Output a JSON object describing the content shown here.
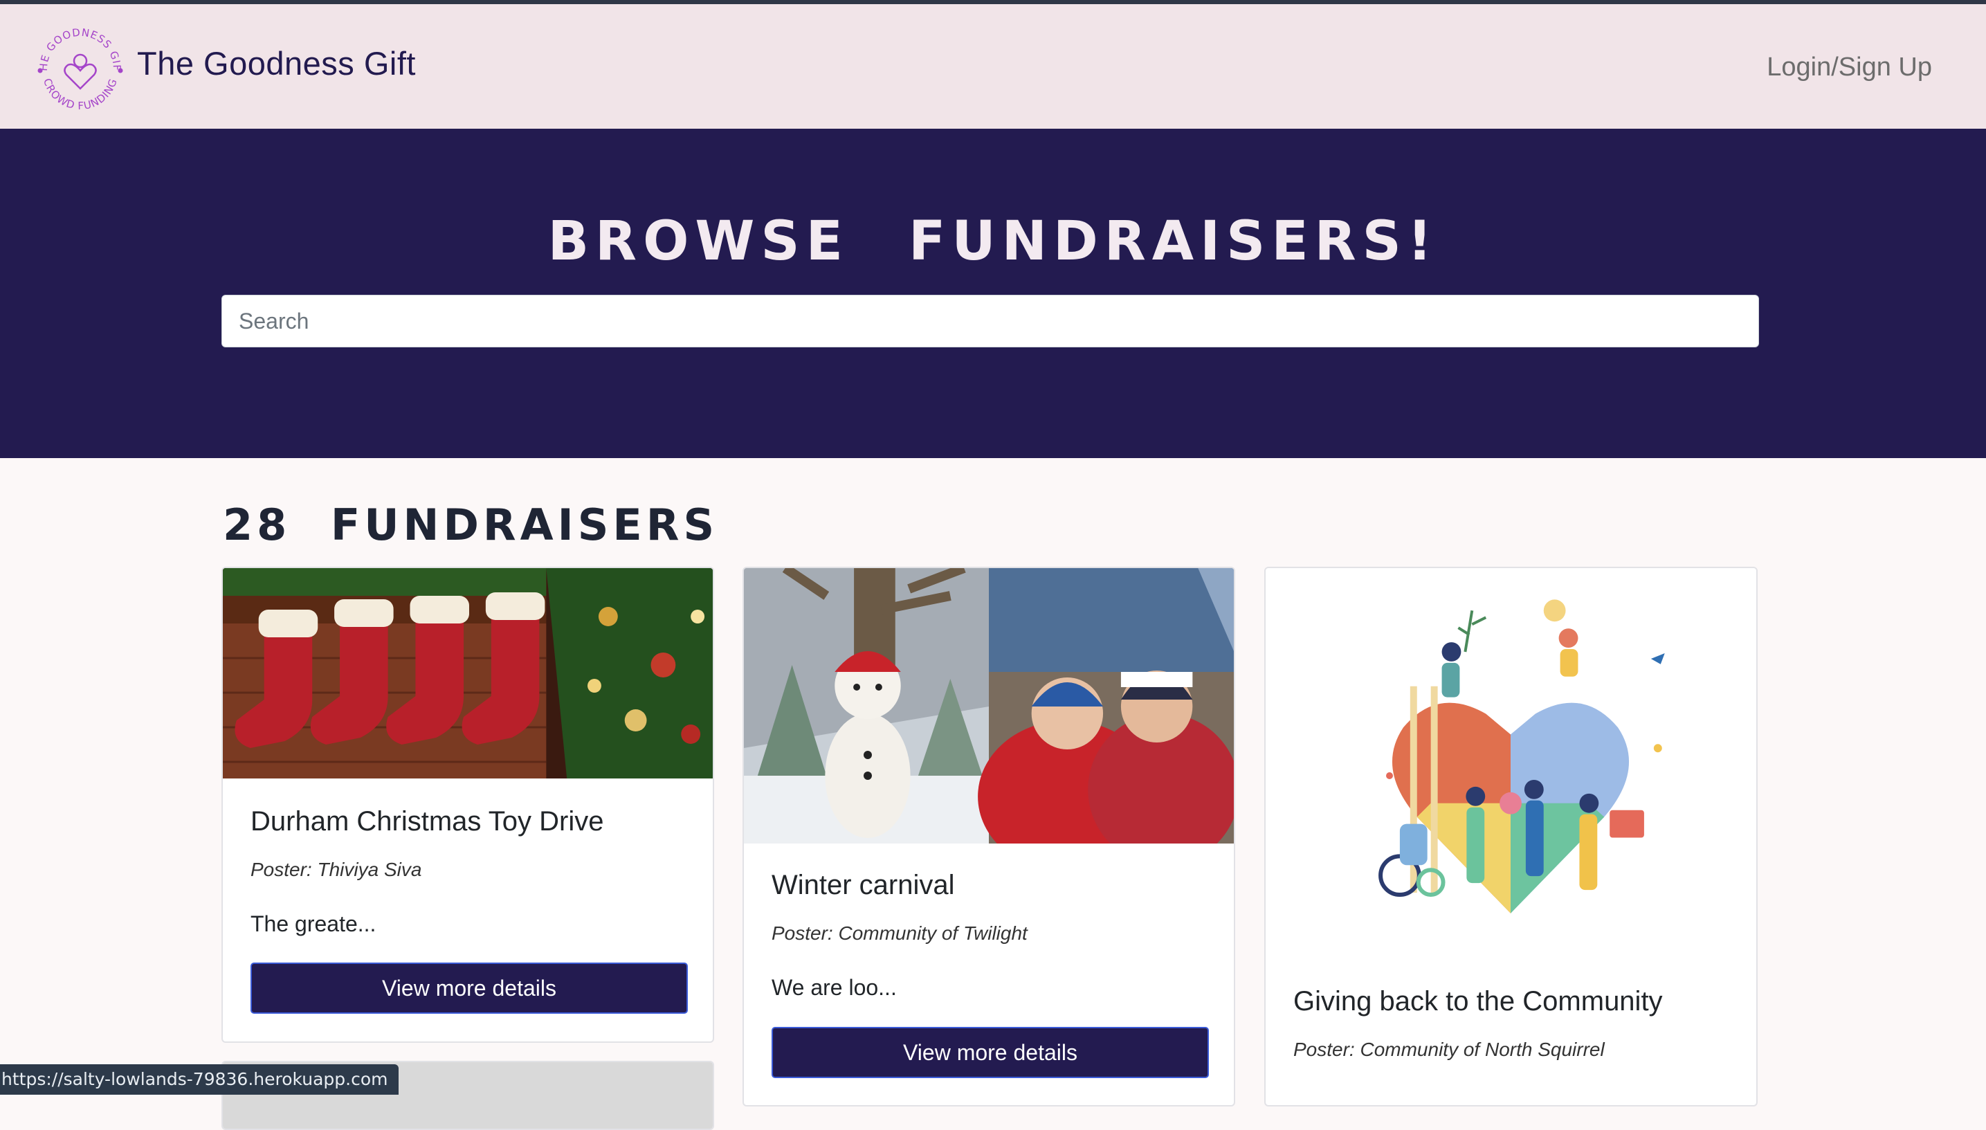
{
  "navbar": {
    "logo_ring_top": "THE GOODNESS GIFT",
    "logo_ring_bottom": "CROWD FUNDING",
    "brand": "The Goodness Gift",
    "login_label": "Login/Sign Up"
  },
  "hero": {
    "title": "BROWSE FUNDRAISERS!",
    "search_placeholder": "Search"
  },
  "listing": {
    "count_title": "28 FUNDRAISERS"
  },
  "cards": [
    {
      "title": "Durham Christmas Toy Drive",
      "poster": "Poster: Thiviya Siva",
      "description": "The greate...",
      "button": "View more details",
      "image": "christmas-stockings-photo"
    },
    {
      "title": "Winter carnival",
      "poster": "Poster: Community of Twilight",
      "description": "We are loo...",
      "button": "View more details",
      "image": "winter-carnival-photo"
    },
    {
      "title": "Giving back to the Community",
      "poster": "Poster: Community of North Squirrel",
      "description": "",
      "button": "",
      "image": "community-puzzle-heart-illustration"
    }
  ],
  "status_bar": {
    "url": "https://salty-lowlands-79836.herokuapp.com"
  },
  "colors": {
    "navy": "#231b50",
    "navbar_bg": "#f1e4e8",
    "page_bg": "#fcf8f8",
    "logo_purple": "#a545c9"
  }
}
